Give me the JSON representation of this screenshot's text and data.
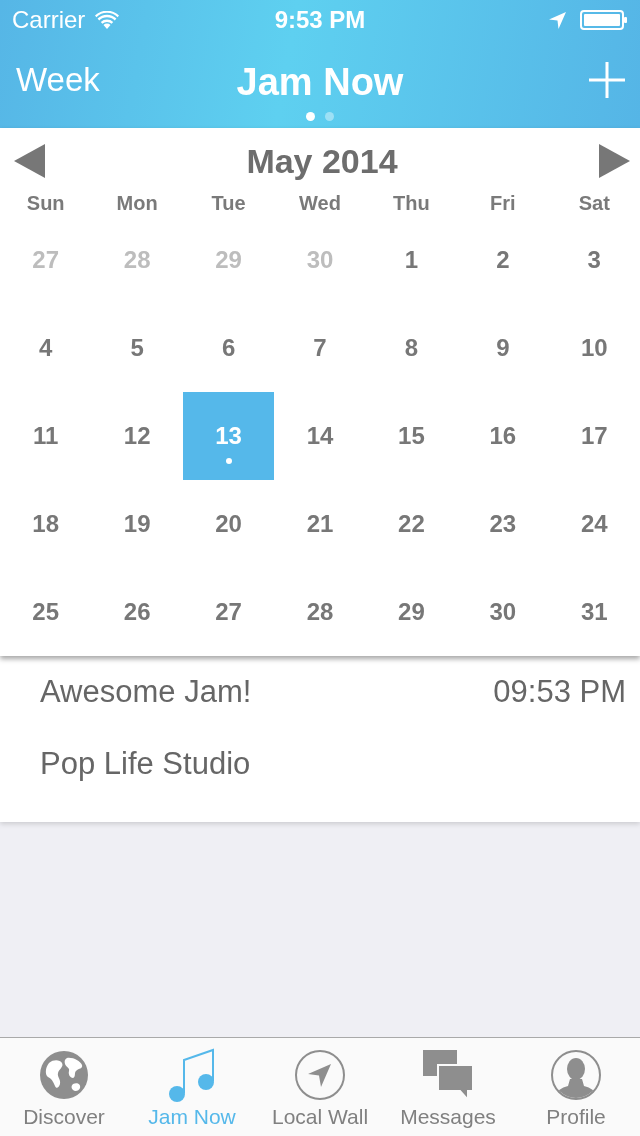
{
  "status_bar": {
    "carrier": "Carrier",
    "time": "9:53 PM"
  },
  "nav_bar": {
    "left_button": "Week",
    "title": "Jam Now",
    "page_dots": [
      {
        "selected": true
      },
      {
        "selected": false
      }
    ]
  },
  "calendar": {
    "month": "May 2014",
    "weekdays": [
      "Sun",
      "Mon",
      "Tue",
      "Wed",
      "Thu",
      "Fri",
      "Sat"
    ],
    "weeks": [
      [
        {
          "day": "27",
          "in_month": false,
          "selected": false,
          "has_event": false
        },
        {
          "day": "28",
          "in_month": false,
          "selected": false,
          "has_event": false
        },
        {
          "day": "29",
          "in_month": false,
          "selected": false,
          "has_event": false
        },
        {
          "day": "30",
          "in_month": false,
          "selected": false,
          "has_event": false
        },
        {
          "day": "1",
          "in_month": true,
          "selected": false,
          "has_event": false
        },
        {
          "day": "2",
          "in_month": true,
          "selected": false,
          "has_event": false
        },
        {
          "day": "3",
          "in_month": true,
          "selected": false,
          "has_event": false
        }
      ],
      [
        {
          "day": "4",
          "in_month": true,
          "selected": false,
          "has_event": false
        },
        {
          "day": "5",
          "in_month": true,
          "selected": false,
          "has_event": false
        },
        {
          "day": "6",
          "in_month": true,
          "selected": false,
          "has_event": false
        },
        {
          "day": "7",
          "in_month": true,
          "selected": false,
          "has_event": false
        },
        {
          "day": "8",
          "in_month": true,
          "selected": false,
          "has_event": false
        },
        {
          "day": "9",
          "in_month": true,
          "selected": false,
          "has_event": false
        },
        {
          "day": "10",
          "in_month": true,
          "selected": false,
          "has_event": false
        }
      ],
      [
        {
          "day": "11",
          "in_month": true,
          "selected": false,
          "has_event": false
        },
        {
          "day": "12",
          "in_month": true,
          "selected": false,
          "has_event": false
        },
        {
          "day": "13",
          "in_month": true,
          "selected": true,
          "has_event": true
        },
        {
          "day": "14",
          "in_month": true,
          "selected": false,
          "has_event": false
        },
        {
          "day": "15",
          "in_month": true,
          "selected": false,
          "has_event": false
        },
        {
          "day": "16",
          "in_month": true,
          "selected": false,
          "has_event": false
        },
        {
          "day": "17",
          "in_month": true,
          "selected": false,
          "has_event": false
        }
      ],
      [
        {
          "day": "18",
          "in_month": true,
          "selected": false,
          "has_event": false
        },
        {
          "day": "19",
          "in_month": true,
          "selected": false,
          "has_event": false
        },
        {
          "day": "20",
          "in_month": true,
          "selected": false,
          "has_event": false
        },
        {
          "day": "21",
          "in_month": true,
          "selected": false,
          "has_event": false
        },
        {
          "day": "22",
          "in_month": true,
          "selected": false,
          "has_event": false
        },
        {
          "day": "23",
          "in_month": true,
          "selected": false,
          "has_event": false
        },
        {
          "day": "24",
          "in_month": true,
          "selected": false,
          "has_event": false
        }
      ],
      [
        {
          "day": "25",
          "in_month": true,
          "selected": false,
          "has_event": false
        },
        {
          "day": "26",
          "in_month": true,
          "selected": false,
          "has_event": false
        },
        {
          "day": "27",
          "in_month": true,
          "selected": false,
          "has_event": false
        },
        {
          "day": "28",
          "in_month": true,
          "selected": false,
          "has_event": false
        },
        {
          "day": "29",
          "in_month": true,
          "selected": false,
          "has_event": false
        },
        {
          "day": "30",
          "in_month": true,
          "selected": false,
          "has_event": false
        },
        {
          "day": "31",
          "in_month": true,
          "selected": false,
          "has_event": false
        }
      ]
    ]
  },
  "event": {
    "title": "Awesome Jam!",
    "time": "09:53 PM",
    "venue": "Pop Life Studio"
  },
  "tab_bar": [
    {
      "label": "Discover",
      "selected": false
    },
    {
      "label": "Jam Now",
      "selected": true
    },
    {
      "label": "Local Wall",
      "selected": false
    },
    {
      "label": "Messages",
      "selected": false
    },
    {
      "label": "Profile",
      "selected": false
    }
  ]
}
